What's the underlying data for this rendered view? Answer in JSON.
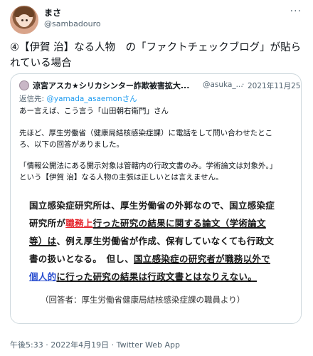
{
  "author": {
    "name": "まさ",
    "handle": "@sambadouro",
    "more_icon": "more-horizontal-icon"
  },
  "tweet_text": "④【伊賀 治】なる人物　の「ファクトチェックブログ」が貼られている場合",
  "quote": {
    "name": "涼宮アスカ★シリカシンター詐欺被害拡大...",
    "handle": "@asuka_...",
    "dot": "·",
    "date": "2021年11月25日",
    "reply_prefix": "返信先: ",
    "reply_to": "@yamada_asaemonさん",
    "lines": [
      "あー言えば、こう言う「山田朝右衛門」さん",
      "先ほど、厚生労働省（健康局結核感染症課）に電話をして問い合わせたとこ",
      "ろ、以下の回答がありました。",
      "「情報公開法にある開示対象は管轄内の行政文書のみ。学術論文は対象外。」",
      "という【伊賀 治】なる人物の主張は正しいとは言えません。"
    ],
    "image": {
      "l1": "国立感染症研究所は、厚生労働省の外郭なので、国立感染症",
      "l2a": "研究所が",
      "l2b": "職務上",
      "l2c": "行った研究の結果に関する論文（学術論文",
      "l3a": "等）は",
      "l3b": "、例え厚生労働省が作成、保有していなくても行政文",
      "l4a": "書の扱いとなる。　但し、",
      "l4b": "国立感染症の研究者が職務以外で",
      "l5a": "個人的",
      "l5b": "に行った研究の結果は行政文書とはなりえない。",
      "footer": "（回答者：厚生労働省健康局結核感染症課の職員より）"
    }
  },
  "meta": "午後5:33 · 2022年4月19日 · Twitter Web App"
}
